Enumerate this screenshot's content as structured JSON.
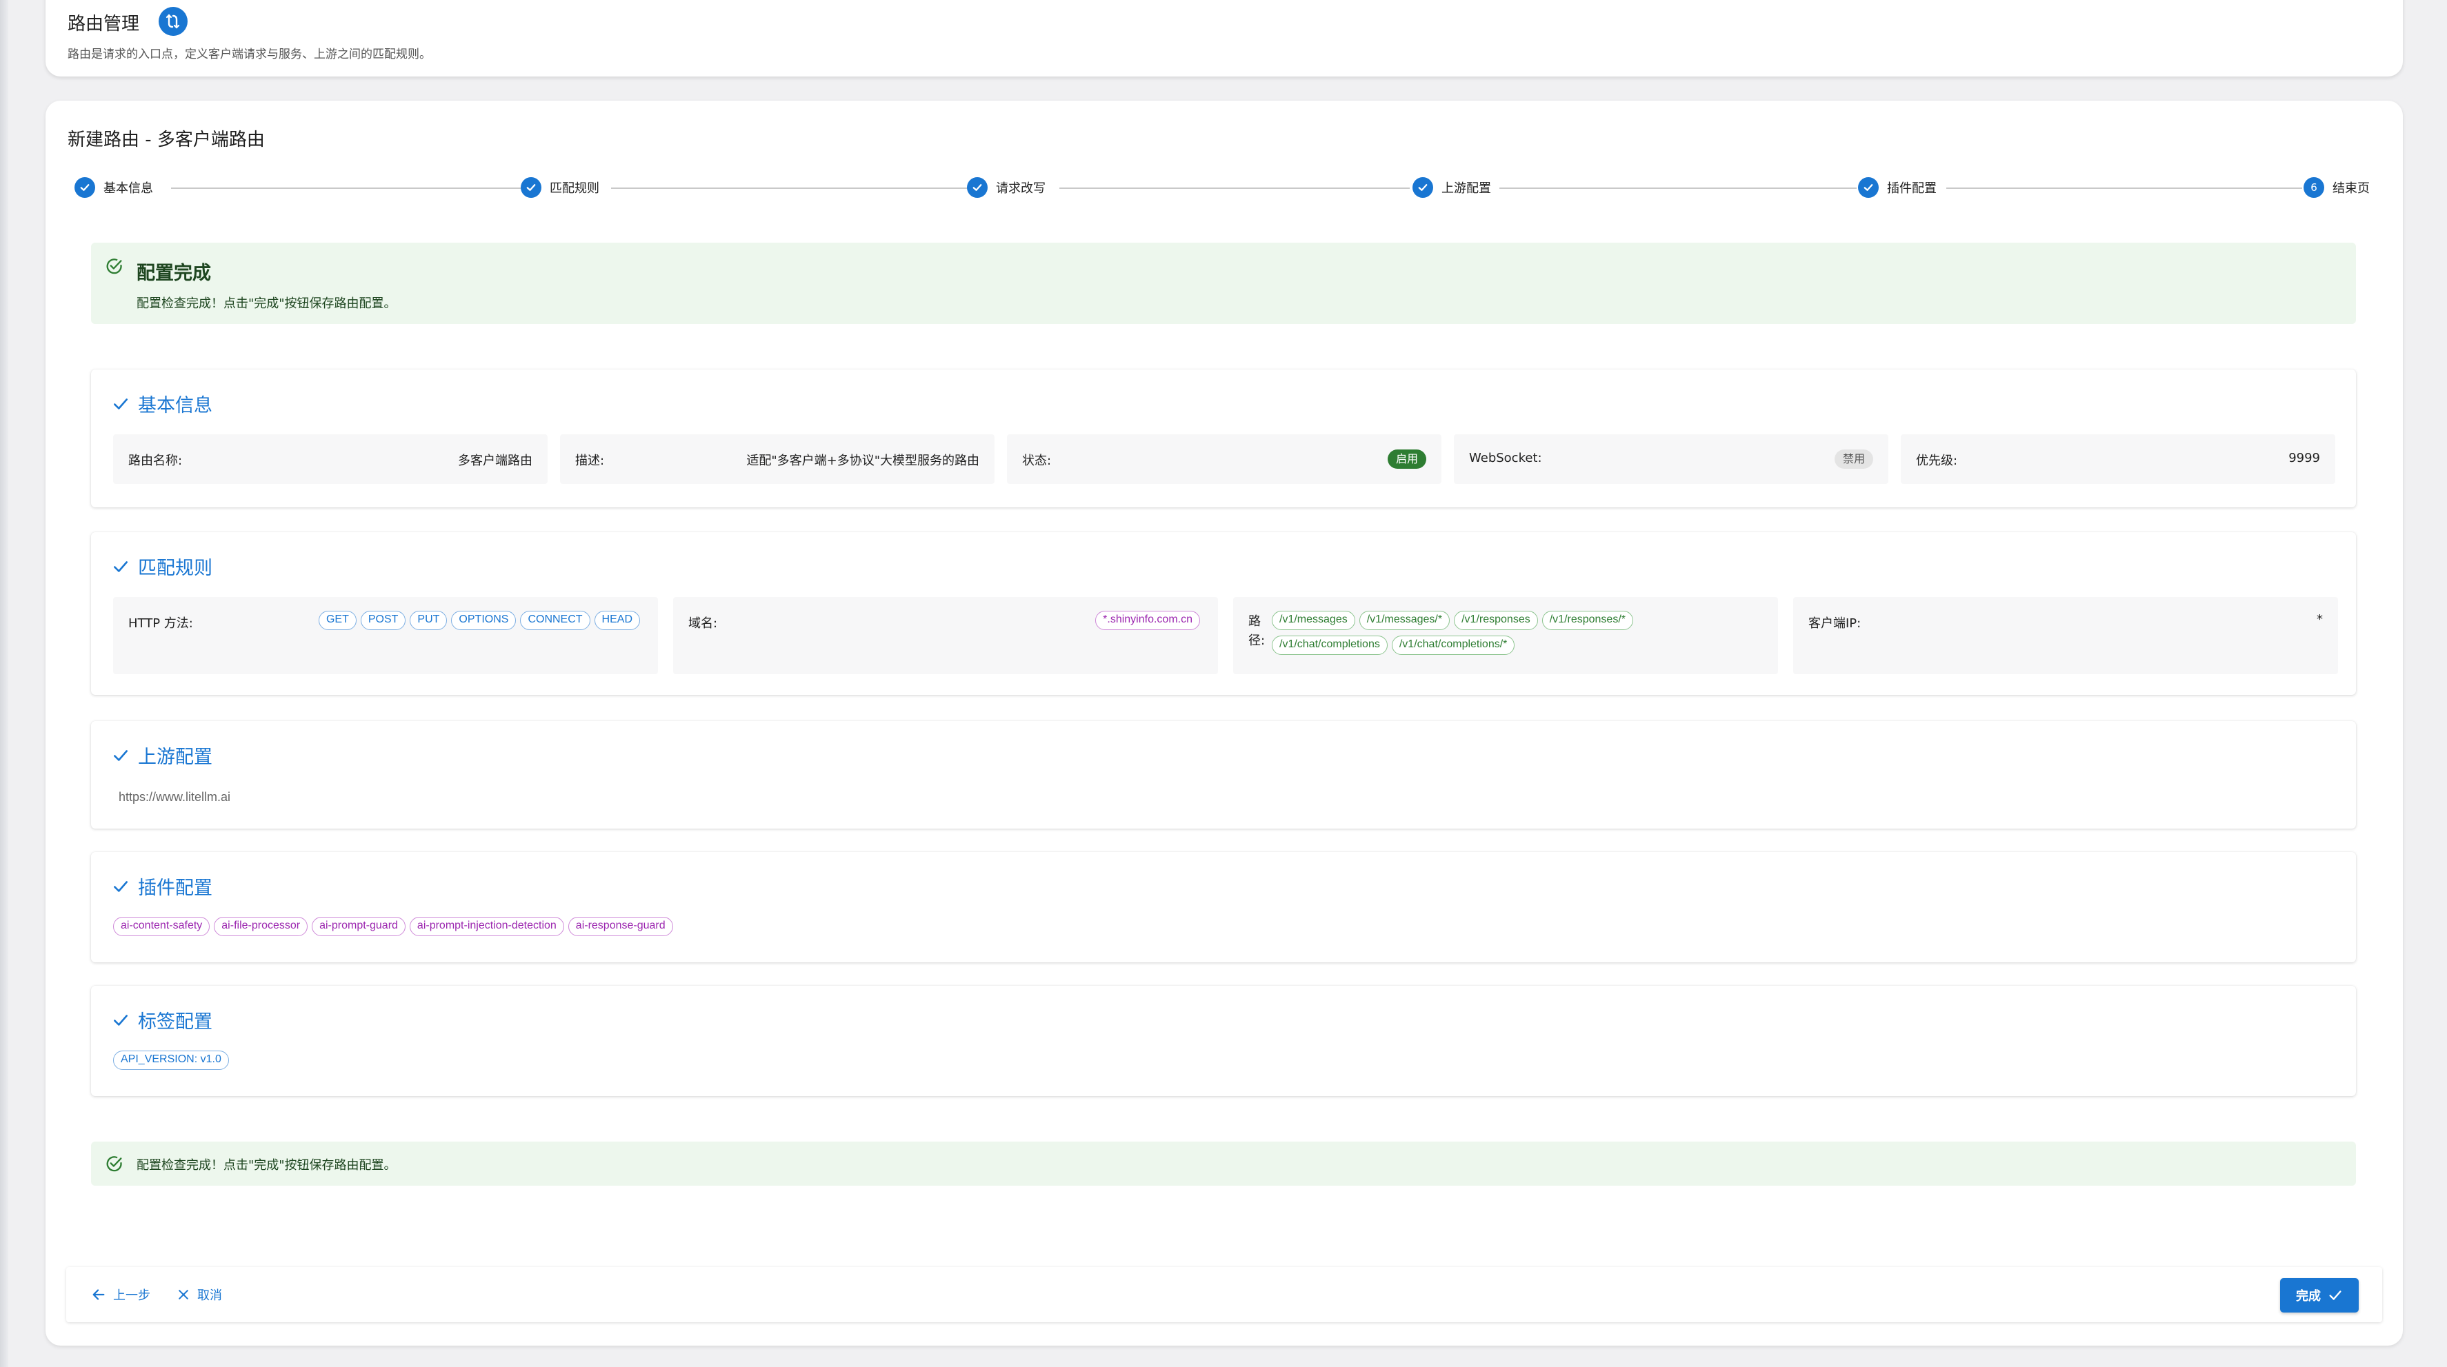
{
  "header": {
    "title": "路由管理",
    "subtitle": "路由是请求的入口点，定义客户端请求与服务、上游之间的匹配规则。"
  },
  "form": {
    "title": "新建路由 - 多客户端路由"
  },
  "stepper": {
    "steps": [
      {
        "label": "基本信息",
        "state": "done"
      },
      {
        "label": "匹配规则",
        "state": "done"
      },
      {
        "label": "请求改写",
        "state": "done"
      },
      {
        "label": "上游配置",
        "state": "done"
      },
      {
        "label": "插件配置",
        "state": "done"
      },
      {
        "label": "结束页",
        "state": "active",
        "number": "6"
      }
    ]
  },
  "banner_top": {
    "title": "配置完成",
    "message": "配置检查完成！点击\"完成\"按钮保存路由配置。"
  },
  "basic_info": {
    "title": "基本信息",
    "route_name_label": "路由名称:",
    "route_name_value": "多客户端路由",
    "desc_label": "描述:",
    "desc_value": "适配\"多客户端+多协议\"大模型服务的路由",
    "status_label": "状态:",
    "status_value": "启用",
    "websocket_label": "WebSocket:",
    "websocket_value": "禁用",
    "priority_label": "优先级:",
    "priority_value": "9999"
  },
  "match_rules": {
    "title": "匹配规则",
    "http_methods_label": "HTTP 方法:",
    "http_methods": [
      "GET",
      "POST",
      "PUT",
      "OPTIONS",
      "CONNECT",
      "HEAD"
    ],
    "domain_label": "域名:",
    "domains": [
      "*.shinyinfo.com.cn"
    ],
    "path_label": "路径:",
    "paths": [
      "/v1/messages",
      "/v1/messages/*",
      "/v1/responses",
      "/v1/responses/*",
      "/v1/chat/completions",
      "/v1/chat/completions/*"
    ],
    "client_ip_label": "客户端IP:",
    "client_ip_value": "*"
  },
  "upstream": {
    "title": "上游配置",
    "url": "https://www.litellm.ai"
  },
  "plugins": {
    "title": "插件配置",
    "items": [
      "ai-content-safety",
      "ai-file-processor",
      "ai-prompt-guard",
      "ai-prompt-injection-detection",
      "ai-response-guard"
    ]
  },
  "labels": {
    "title": "标签配置",
    "items": [
      "API_VERSION: v1.0"
    ]
  },
  "banner_bottom": {
    "message": "配置检查完成！点击\"完成\"按钮保存路由配置。"
  },
  "footer": {
    "prev_label": "上一步",
    "cancel_label": "取消",
    "finish_label": "完成"
  },
  "colors": {
    "primary": "#1976d2",
    "success": "#2e7d32",
    "success_bg": "#edf7ed",
    "chip_purple": "#9c27b0"
  }
}
